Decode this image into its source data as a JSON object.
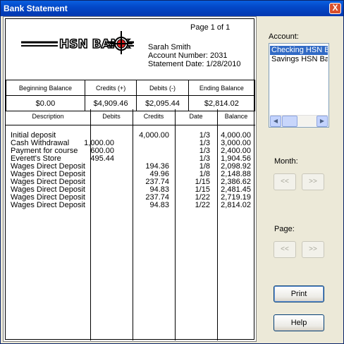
{
  "window": {
    "title": "Bank Statement",
    "close_glyph": "X"
  },
  "statement": {
    "bank_logo_text": "HSN BANK",
    "page_label": "Page 1 of 1",
    "customer_name": "Sarah Smith",
    "account_number": "Account Number: 2031",
    "statement_date": "Statement Date: 1/28/2010",
    "summary_headers": [
      "Beginning Balance",
      "Credits (+)",
      "Debits (-)",
      "Ending Balance"
    ],
    "summary_values": [
      "$0.00",
      "$4,909.46",
      "$2,095.44",
      "$2,814.02"
    ],
    "columns": [
      "Description",
      "Debits",
      "Credits",
      "Date",
      "Balance"
    ],
    "transactions": [
      {
        "desc": "Initial deposit",
        "debit": "",
        "credit": "4,000.00",
        "date": "1/3",
        "balance": "4,000.00"
      },
      {
        "desc": "Cash Withdrawal",
        "debit": "1,000.00",
        "credit": "",
        "date": "1/3",
        "balance": "3,000.00"
      },
      {
        "desc": "Payment for course",
        "debit": "600.00",
        "credit": "",
        "date": "1/3",
        "balance": "2,400.00"
      },
      {
        "desc": "Everett's Store",
        "debit": "495.44",
        "credit": "",
        "date": "1/3",
        "balance": "1,904.56"
      },
      {
        "desc": "Wages Direct Deposit",
        "debit": "",
        "credit": "194.36",
        "date": "1/8",
        "balance": "2,098.92"
      },
      {
        "desc": "Wages Direct Deposit",
        "debit": "",
        "credit": "49.96",
        "date": "1/8",
        "balance": "2,148.88"
      },
      {
        "desc": "Wages Direct Deposit",
        "debit": "",
        "credit": "237.74",
        "date": "1/15",
        "balance": "2,386.62"
      },
      {
        "desc": "Wages Direct Deposit",
        "debit": "",
        "credit": "94.83",
        "date": "1/15",
        "balance": "2,481.45"
      },
      {
        "desc": "Wages Direct Deposit",
        "debit": "",
        "credit": "237.74",
        "date": "1/22",
        "balance": "2,719.19"
      },
      {
        "desc": "Wages Direct Deposit",
        "debit": "",
        "credit": "94.83",
        "date": "1/22",
        "balance": "2,814.02"
      }
    ]
  },
  "side": {
    "account_label": "Account:",
    "accounts": [
      "Checking HSN Bank",
      "Savings HSN Bank"
    ],
    "selected_account": "Checking HSN Bank",
    "month_label": "Month:",
    "page_label": "Page:",
    "prev_glyph": "<<",
    "next_glyph": ">>",
    "print_label": "Print",
    "help_label": "Help"
  },
  "colors": {
    "titlebar": "#0348c8",
    "selection": "#316ac5",
    "window_bg": "#ece9d8"
  }
}
